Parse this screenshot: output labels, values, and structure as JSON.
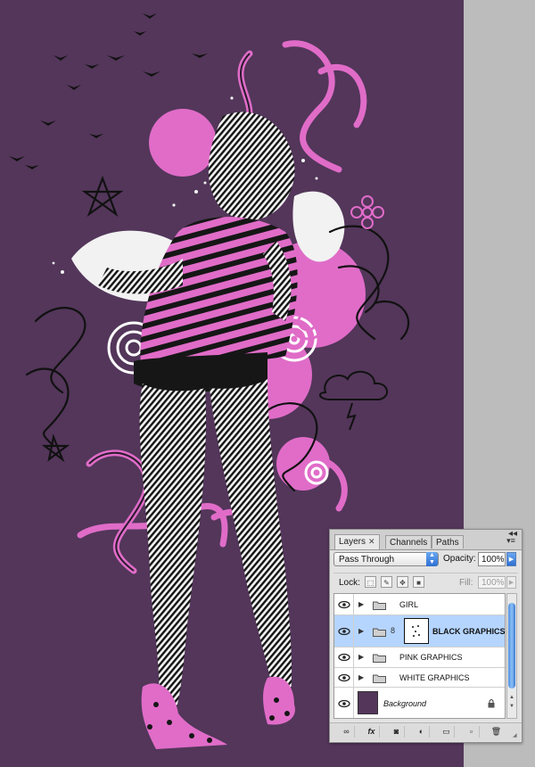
{
  "colors": {
    "artwork_background": "#53365a",
    "pink": "#e06cc8",
    "black": "#111111",
    "selection": "#b5d5ff"
  },
  "layers_panel": {
    "tabs": [
      {
        "label": "Layers",
        "active": true
      },
      {
        "label": "Channels",
        "active": false
      },
      {
        "label": "Paths",
        "active": false
      }
    ],
    "blend_mode": "Pass Through",
    "opacity_label": "Opacity:",
    "opacity_value": "100%",
    "lock_label": "Lock:",
    "fill_label": "Fill:",
    "fill_value": "100%",
    "layers": [
      {
        "name": "GIRL",
        "type": "group",
        "visible": true,
        "selected": false
      },
      {
        "name": "BLACK GRAPHICS",
        "type": "group",
        "visible": true,
        "selected": true,
        "has_mask": true
      },
      {
        "name": "PINK GRAPHICS",
        "type": "group",
        "visible": true,
        "selected": false
      },
      {
        "name": "WHITE GRAPHICS",
        "type": "group",
        "visible": true,
        "selected": false
      },
      {
        "name": "Background",
        "type": "background",
        "visible": true,
        "selected": false,
        "locked": true
      }
    ],
    "bottom_buttons": [
      "link-icon",
      "fx-icon",
      "add-mask-icon",
      "adjustment-layer-icon",
      "new-group-icon",
      "new-layer-icon",
      "trash-icon"
    ],
    "fx_label": "fx"
  }
}
